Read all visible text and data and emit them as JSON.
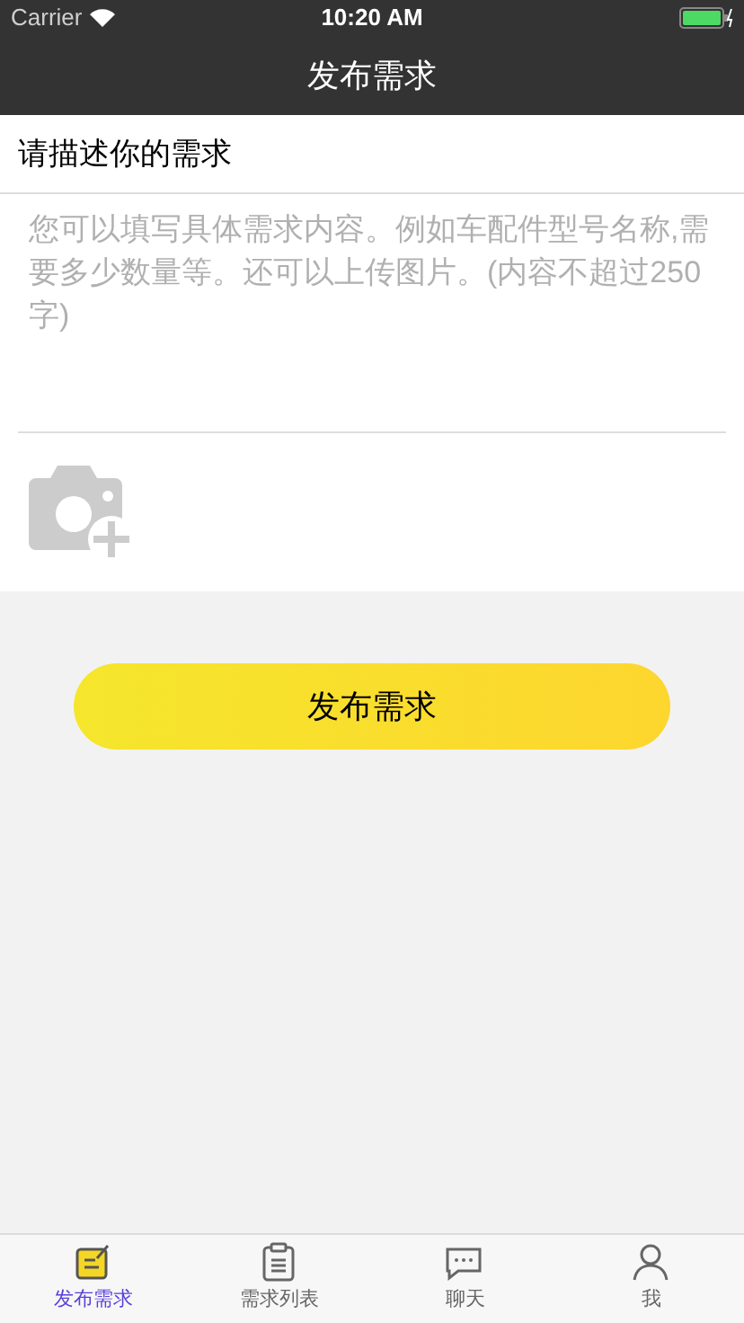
{
  "status_bar": {
    "carrier": "Carrier",
    "time": "10:20 AM"
  },
  "nav": {
    "title": "发布需求"
  },
  "form": {
    "label": "请描述你的需求",
    "placeholder": "您可以填写具体需求内容。例如车配件型号名称,需要多少数量等。还可以上传图片。(内容不超过250字)"
  },
  "submit": "发布需求",
  "tabs": [
    {
      "label": "发布需求",
      "kind": "post",
      "selected": true
    },
    {
      "label": "需求列表",
      "kind": "list",
      "selected": false
    },
    {
      "label": "聊天",
      "kind": "chat",
      "selected": false
    },
    {
      "label": "我",
      "kind": "me",
      "selected": false
    }
  ]
}
